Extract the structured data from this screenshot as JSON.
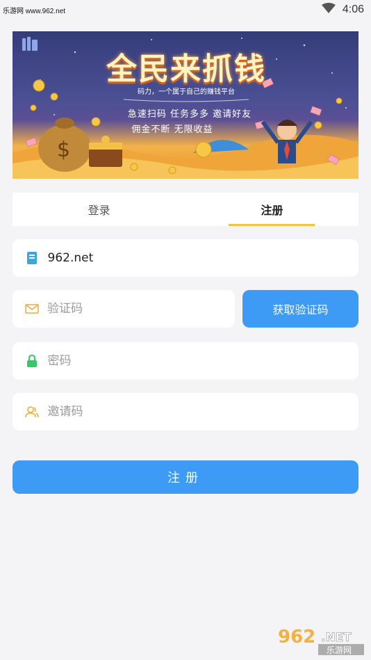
{
  "status_bar": {
    "carrier": "乐游网 www.962.net",
    "time": "4:06",
    "wifi_icon": "wifi-icon"
  },
  "banner": {
    "title": "全民来抓钱",
    "subtitle": "码力，一个属于自己的赚钱平台",
    "line1": "急速扫码  任务多多  邀请好友",
    "line2": "佣金不断  无限收益",
    "colors": {
      "sky_top": "#353c7a",
      "wave": "#f3b248"
    }
  },
  "tabs": [
    {
      "label": "登录",
      "active": false
    },
    {
      "label": "注册",
      "active": true
    }
  ],
  "form": {
    "phone": {
      "value": "962.net",
      "placeholder": "",
      "icon": "phone-icon"
    },
    "code": {
      "value": "",
      "placeholder": "验证码",
      "icon": "mail-icon"
    },
    "get_code_label": "获取验证码",
    "password": {
      "value": "",
      "placeholder": "密码",
      "icon": "lock-icon"
    },
    "invite": {
      "value": "",
      "placeholder": "邀请码",
      "icon": "user-icon"
    },
    "submit_label": "注册"
  },
  "watermark": {
    "brand": "962.NET",
    "text": "乐游网"
  },
  "colors": {
    "accent": "#3d9bf5",
    "tab_underline": "#f5c23e",
    "page_bg": "#f4f4f6"
  }
}
